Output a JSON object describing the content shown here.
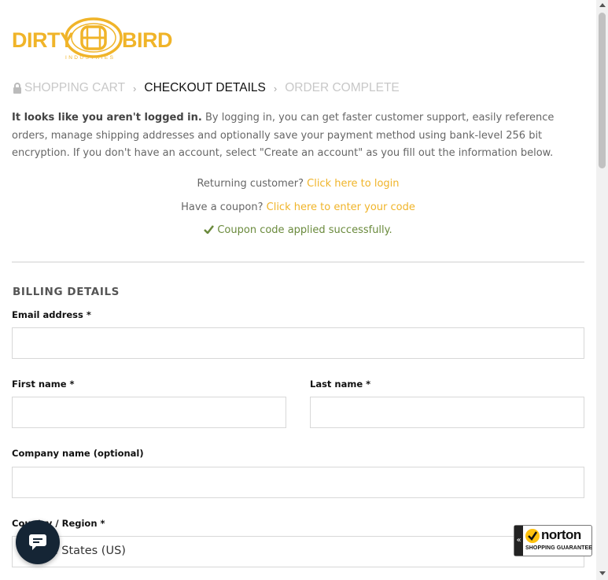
{
  "logo": {
    "left_word": "DIRTY",
    "right_word": "BIRD",
    "subtitle": "INDUSTRIES",
    "brand_color": "#f0b429"
  },
  "breadcrumb": {
    "items": [
      {
        "label": "SHOPPING CART",
        "state": "done"
      },
      {
        "label": "CHECKOUT DETAILS",
        "state": "active"
      },
      {
        "label": "ORDER COMPLETE",
        "state": "pending"
      }
    ],
    "separator": "›"
  },
  "notice": {
    "bold": "It looks like you aren't logged in.",
    "body": " By logging in, you can get faster customer support, easily reference orders, manage shipping addresses and optionally save your payment method using bank-level 256 bit encryption. If you don't have an account, select \"Create an account\" as you fill out the information below."
  },
  "returning": {
    "prefix": "Returning customer?",
    "link": "Click here to login"
  },
  "coupon": {
    "prefix": "Have a coupon?",
    "link": "Click here to enter your code",
    "success": "Coupon code applied successfully.",
    "success_color": "#6a8a3c"
  },
  "billing": {
    "title": "BILLING DETAILS",
    "email_label": "Email address *",
    "first_name_label": "First name *",
    "last_name_label": "Last name *",
    "company_label": "Company name (optional)",
    "country_label": "Country / Region *",
    "country_value": "United States (US)"
  },
  "norton": {
    "name": "norton",
    "sub": "SHOPPING GUARANTEE",
    "tab": "«"
  },
  "icons": {
    "lock": "lock-icon",
    "check": "check-icon",
    "chat": "chat-icon"
  }
}
